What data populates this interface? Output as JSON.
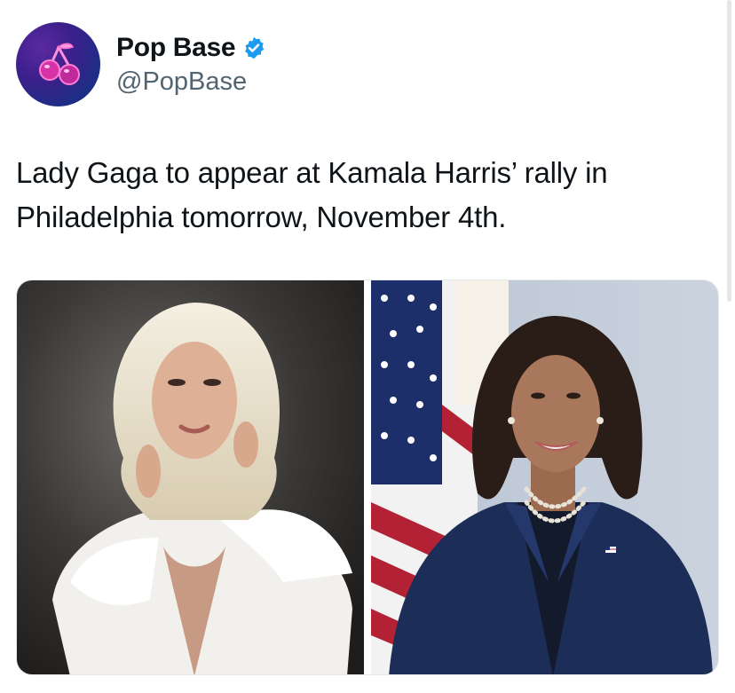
{
  "user": {
    "display_name": "Pop Base",
    "handle": "@PopBase",
    "verified": true,
    "avatar_icon": "cherry-icon",
    "avatar_colors": [
      "#3b1f8a",
      "#12246f"
    ]
  },
  "tweet": {
    "text": "Lady Gaga to appear at Kamala Harris’ rally in Philadelphia tomorrow, November 4th."
  },
  "media": {
    "photos": [
      {
        "subject": "lady-gaga-photo"
      },
      {
        "subject": "kamala-harris-photo"
      }
    ]
  },
  "colors": {
    "verified_badge": "#1d9bf0",
    "text": "#0f1419",
    "secondary_text": "#536471"
  }
}
